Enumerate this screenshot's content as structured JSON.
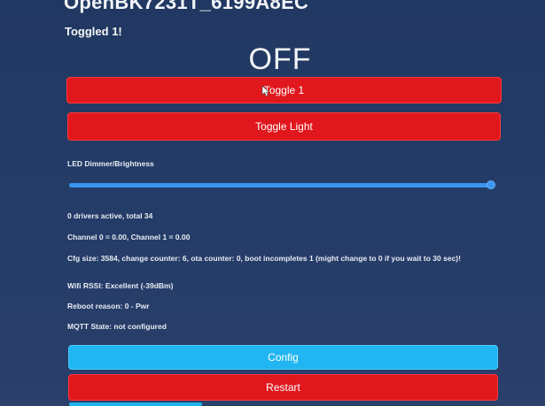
{
  "header": {
    "device_name": "OpenBK7231T_6199A8EC",
    "message": "Toggled 1!",
    "state": "OFF"
  },
  "buttons": {
    "toggle1": "Toggle 1",
    "toggle_light": "Toggle Light",
    "config": "Config",
    "restart": "Restart"
  },
  "dimmer": {
    "label": "LED Dimmer/Brightness",
    "value_fraction": 1.0
  },
  "info": {
    "drivers": "0 drivers active, total 34",
    "channels": "Channel 0 = 0.00, Channel 1 = 0.00",
    "cfg": "Cfg size: 3584, change counter: 6, ota counter: 0, boot incompletes 1 (might change to 0 if you wait to 30 sec)!",
    "wifi": "Wifi RSSI: Excellent (-39dBm)",
    "reboot": "Reboot reason: 0 - Pwr",
    "mqtt": "MQTT State: not configured"
  },
  "colors": {
    "background": "#223a66",
    "red_button": "#e0171d",
    "blue_button": "#21b6f2",
    "slider": "#3b96f0"
  }
}
